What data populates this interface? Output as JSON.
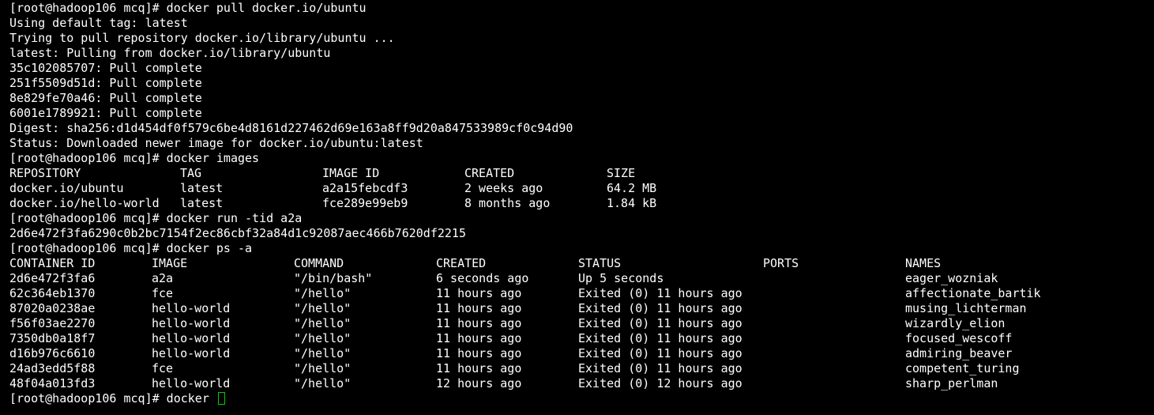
{
  "colors": {
    "background": "#000000",
    "text": "#ffffff",
    "cursor": "#00d000"
  },
  "pull_block": {
    "lines": [
      "[root@hadoop106 mcq]# docker pull docker.io/ubuntu",
      "Using default tag: latest",
      "Trying to pull repository docker.io/library/ubuntu ...",
      "latest: Pulling from docker.io/library/ubuntu",
      "35c102085707: Pull complete",
      "251f5509d51d: Pull complete",
      "8e829fe70a46: Pull complete",
      "6001e1789921: Pull complete",
      "Digest: sha256:d1d454df0f579c6be4d8161d227462d69e163a8ff9d20a847533989cf0c94d90",
      "Status: Downloaded newer image for docker.io/ubuntu:latest",
      "[root@hadoop106 mcq]# docker images"
    ]
  },
  "images_table": {
    "headers": [
      "REPOSITORY",
      "TAG",
      "IMAGE ID",
      "CREATED",
      "SIZE"
    ],
    "rows": [
      [
        "docker.io/ubuntu",
        "latest",
        "a2a15febcdf3",
        "2 weeks ago",
        "64.2 MB"
      ],
      [
        "docker.io/hello-world",
        "latest",
        "fce289e99eb9",
        "8 months ago",
        "1.84 kB"
      ]
    ]
  },
  "run_block": {
    "lines": [
      "[root@hadoop106 mcq]# docker run -tid a2a",
      "2d6e472f3fa6290c0b2bc7154f2ec86cbf32a84d1c92087aec466b7620df2215",
      "[root@hadoop106 mcq]# docker ps -a"
    ]
  },
  "ps_table": {
    "headers": [
      "CONTAINER ID",
      "IMAGE",
      "COMMAND",
      "CREATED",
      "STATUS",
      "PORTS",
      "NAMES"
    ],
    "rows": [
      [
        "2d6e472f3fa6",
        "a2a",
        "\"/bin/bash\"",
        "6 seconds ago",
        "Up 5 seconds",
        "",
        "eager_wozniak"
      ],
      [
        "62c364eb1370",
        "fce",
        "\"/hello\"",
        "11 hours ago",
        "Exited (0) 11 hours ago",
        "",
        "affectionate_bartik"
      ],
      [
        "87020a0238ae",
        "hello-world",
        "\"/hello\"",
        "11 hours ago",
        "Exited (0) 11 hours ago",
        "",
        "musing_lichterman"
      ],
      [
        "f56f03ae2270",
        "hello-world",
        "\"/hello\"",
        "11 hours ago",
        "Exited (0) 11 hours ago",
        "",
        "wizardly_elion"
      ],
      [
        "7350db0a18f7",
        "hello-world",
        "\"/hello\"",
        "11 hours ago",
        "Exited (0) 11 hours ago",
        "",
        "focused_wescoff"
      ],
      [
        "d16b976c6610",
        "hello-world",
        "\"/hello\"",
        "11 hours ago",
        "Exited (0) 11 hours ago",
        "",
        "admiring_beaver"
      ],
      [
        "24ad3edd5f88",
        "fce",
        "\"/hello\"",
        "11 hours ago",
        "Exited (0) 11 hours ago",
        "",
        "competent_turing"
      ],
      [
        "48f04a013fd3",
        "hello-world",
        "\"/hello\"",
        "12 hours ago",
        "Exited (0) 12 hours ago",
        "",
        "sharp_perlman"
      ]
    ]
  },
  "prompt": {
    "text": "[root@hadoop106 mcq]# docker "
  },
  "cursor_icon": "block-cursor-icon"
}
